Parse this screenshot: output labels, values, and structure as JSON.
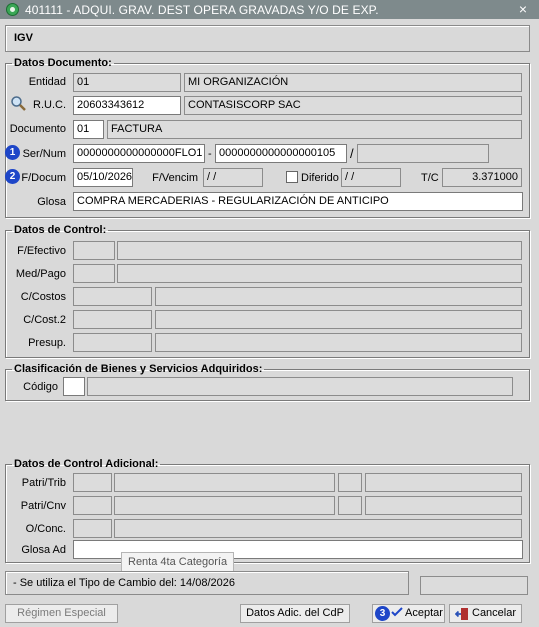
{
  "window": {
    "title": "401111 - ADQUI. GRAV. DEST OPERA GRAVADAS Y/O DE EXP.",
    "close_glyph": "×"
  },
  "header": {
    "tax_label": "IGV"
  },
  "datos_documento": {
    "legend": "Datos Documento:",
    "entidad": {
      "label": "Entidad",
      "code": "01",
      "name": "MI ORGANIZACIÓN"
    },
    "ruc": {
      "label": "R.U.C.",
      "value": "20603343612",
      "name": "CONTASISCORP SAC"
    },
    "documento": {
      "label": "Documento",
      "code": "01",
      "name": "FACTURA"
    },
    "sernum": {
      "badge": "1",
      "label": "Ser/Num",
      "serie": "0000000000000000FLO1",
      "dash": "-",
      "numero": "0000000000000000105",
      "slash": "/",
      "extra": ""
    },
    "fdocum": {
      "badge": "2",
      "label": "F/Docum",
      "value": "05/10/2026"
    },
    "fvencim": {
      "label": "F/Vencim",
      "value": " / /"
    },
    "diferido": {
      "label": "Diferido",
      "value": " / /"
    },
    "tc": {
      "label": "T/C",
      "value": "3.371000"
    },
    "glosa": {
      "label": "Glosa",
      "value": "COMPRA MERCADERIAS -  REGULARIZACIÓN DE ANTICIPO"
    }
  },
  "datos_control": {
    "legend": "Datos de Control:",
    "fefectivo": "F/Efectivo",
    "medpago": "Med/Pago",
    "ccostos": "C/Costos",
    "ccost2": "C/Cost.2",
    "presup": "Presup."
  },
  "clasificacion": {
    "legend": "Clasificación de Bienes y Servicios Adquiridos:",
    "codigo": "Código"
  },
  "control_adicional": {
    "legend": "Datos de Control Adicional:",
    "patritrib": "Patri/Trib",
    "patricnv": "Patri/Cnv",
    "oconc": "O/Conc.",
    "glosa_ad": "Glosa Ad",
    "tooltip": "Renta 4ta Categoría"
  },
  "status": {
    "message": "- Se utiliza el Tipo de Cambio del: 14/08/2026"
  },
  "buttons": {
    "regimen": "Régimen Especial",
    "datos_adic": "Datos Adic. del CdP",
    "aceptar_badge": "3",
    "aceptar": "Aceptar",
    "cancelar": "Cancelar"
  },
  "colors": {
    "titlebar": "#7e8a8c",
    "badge": "#1e46c8",
    "background": "#d9d9d9"
  }
}
